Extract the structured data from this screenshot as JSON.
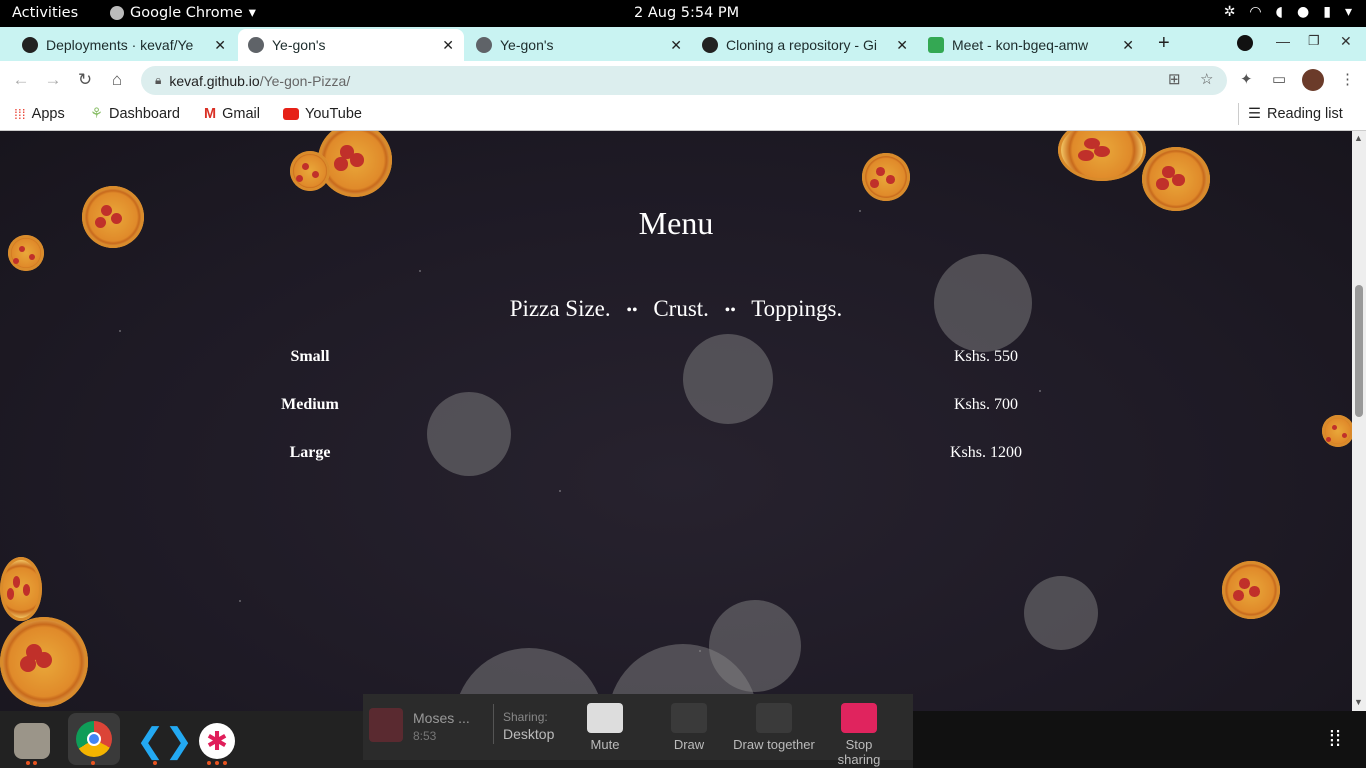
{
  "system_bar": {
    "activities": "Activities",
    "app_name": "Google Chrome",
    "clock": "2 Aug   5:54 PM"
  },
  "tabs": [
    {
      "title": "Deployments · kevaf/Ye"
    },
    {
      "title": "Ye-gon's"
    },
    {
      "title": "Ye-gon's"
    },
    {
      "title": "Cloning a repository - Gi"
    },
    {
      "title": "Meet - kon-bgeq-amw"
    }
  ],
  "address_bar": {
    "host": "kevaf.github.io",
    "path": "/Ye-gon-Pizza/"
  },
  "bookmarks": {
    "apps": "Apps",
    "dashboard": "Dashboard",
    "gmail": "Gmail",
    "youtube": "YouTube",
    "reading_list": "Reading list"
  },
  "page": {
    "title": "Menu",
    "options": [
      "Pizza Size.",
      "Crust.",
      "Toppings."
    ],
    "separator": "••",
    "rows": [
      {
        "size": "Small",
        "price": "Kshs. 550"
      },
      {
        "size": "Medium",
        "price": "Kshs. 700"
      },
      {
        "size": "Large",
        "price": "Kshs. 1200"
      }
    ]
  },
  "screen_share": {
    "presenter": "Moses ...",
    "time": "8:53",
    "sharing_label": "Sharing:",
    "sharing_target": "Desktop",
    "mute": "Mute",
    "draw": "Draw",
    "draw_together": "Draw together",
    "stop_sharing": "Stop sharing"
  },
  "colors": {
    "chrome_accent": "#c9f3f2",
    "page_bg": "#1e1a25",
    "stop_sharing": "#e0245e"
  }
}
